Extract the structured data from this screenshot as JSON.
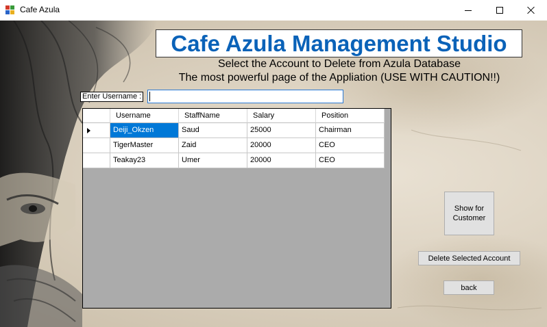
{
  "window": {
    "title": "Cafe Azula",
    "controls": {
      "minimize": "minimize",
      "maximize": "maximize",
      "close": "close"
    }
  },
  "header": {
    "title": "Cafe Azula Management Studio",
    "subtitle1": "Select the Account to Delete from Azula Database",
    "subtitle2": "The most powerful page of the Appliation (USE WITH CAUTION!!)"
  },
  "search": {
    "label": "Enter Username :",
    "value": "",
    "placeholder": ""
  },
  "grid": {
    "columns": [
      "Username",
      "StaffName",
      "Salary",
      "Position"
    ],
    "rows": [
      {
        "username": "Deiji_Okzen",
        "staffname": "Saud",
        "salary": "25000",
        "position": "Chairman",
        "selected": true
      },
      {
        "username": "TigerMaster",
        "staffname": "Zaid",
        "salary": "20000",
        "position": "CEO",
        "selected": false
      },
      {
        "username": "Teakay23",
        "staffname": "Umer",
        "salary": "20000",
        "position": "CEO",
        "selected": false
      }
    ]
  },
  "buttons": {
    "show_line1": "Show for",
    "show_line2": "Customer",
    "delete": "Delete Selected Account",
    "back": "back"
  },
  "colors": {
    "heading": "#0a62b8",
    "selection": "#0078d7",
    "grid_background": "#ababab"
  }
}
